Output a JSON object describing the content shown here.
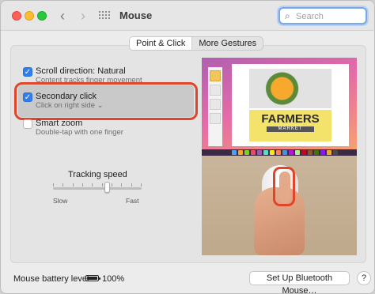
{
  "window": {
    "title": "Mouse"
  },
  "toolbar": {
    "back_icon": "chevron-left-icon",
    "forward_icon": "chevron-right-icon",
    "show_all_icon": "grid-icon"
  },
  "search": {
    "placeholder": "Search",
    "value": "",
    "icon": "search-icon"
  },
  "tabs": [
    {
      "label": "Point & Click",
      "active": true
    },
    {
      "label": "More Gestures",
      "active": false
    }
  ],
  "options": [
    {
      "label": "Scroll direction: Natural",
      "sub": "Content tracks finger movement",
      "checked": true
    },
    {
      "label": "Secondary click",
      "sub": "Click on right side",
      "checked": true,
      "has_menu": true,
      "highlighted": true
    },
    {
      "label": "Smart zoom",
      "sub": "Double-tap with one finger",
      "checked": false
    }
  ],
  "tracking": {
    "title": "Tracking speed",
    "min_label": "Slow",
    "max_label": "Fast",
    "level": 0.62,
    "tick_count": 10
  },
  "preview": {
    "doc_title": "FARMERS",
    "doc_subtitle": "MARKET"
  },
  "battery": {
    "label": "Mouse battery level:",
    "percent": "100%",
    "level": 1.0
  },
  "bluetooth_button": "Set Up Bluetooth Mouse…",
  "help_button": "?",
  "colors": {
    "accent": "#2f7ff0",
    "annotation": "#e0452b"
  }
}
